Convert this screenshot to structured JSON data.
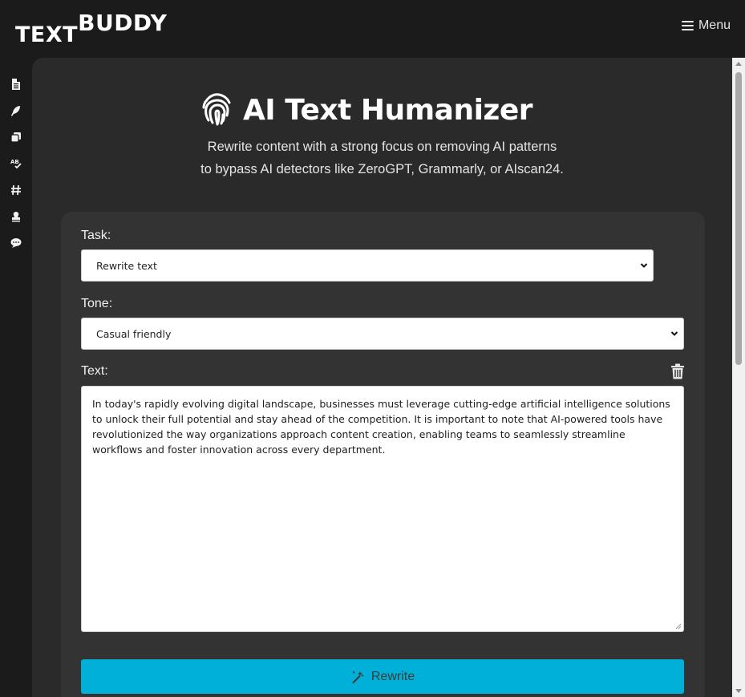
{
  "header": {
    "logo_part1": "TEXT",
    "logo_part2": "BUDDY",
    "menu_label": "Menu"
  },
  "sidebar": {
    "icons": [
      "document-icon",
      "feather-icon",
      "copy-icon",
      "spellcheck-icon",
      "hashtag-icon",
      "stamp-icon",
      "chat-icon"
    ]
  },
  "hero": {
    "title": "AI Text Humanizer",
    "subtitle_line1": "Rewrite content with a strong focus on removing AI patterns",
    "subtitle_line2": "to bypass AI detectors like ZeroGPT, Grammarly, or AIscan24."
  },
  "form": {
    "task_label": "Task:",
    "task_value": "Rewrite text",
    "tone_label": "Tone:",
    "tone_value": "Casual friendly",
    "text_label": "Text:",
    "text_value": "In today's rapidly evolving digital landscape, businesses must leverage cutting-edge artificial intelligence solutions to unlock their full potential and stay ahead of the competition. It is important to note that AI-powered tools have revolutionized the way organizations approach content creation, enabling teams to seamlessly streamline workflows and foster innovation across every department.",
    "submit_label": "Rewrite"
  },
  "colors": {
    "background": "#1b1b1b",
    "panel": "#2a2a2a",
    "card": "#333333",
    "accent": "#00b0d8"
  }
}
